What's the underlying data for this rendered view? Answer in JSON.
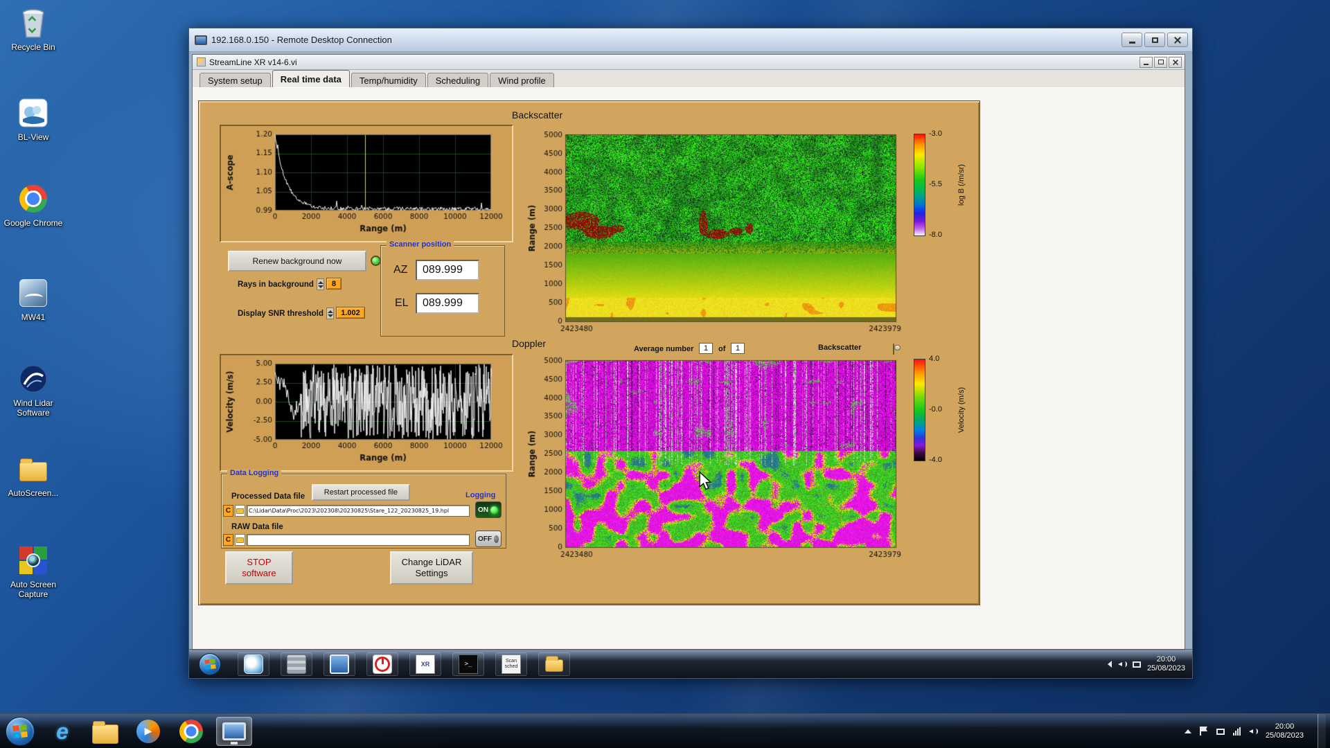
{
  "host": {
    "desktop_icons": [
      {
        "label": "Recycle Bin"
      },
      {
        "label": "BL-View"
      },
      {
        "label": "Google Chrome"
      },
      {
        "label": "MW41"
      },
      {
        "label": "Wind Lidar Software"
      },
      {
        "label": "AutoScreen..."
      },
      {
        "label": "Auto Screen Capture"
      }
    ],
    "taskbar": {
      "clock_time": "20:00",
      "clock_date": "25/08/2023"
    }
  },
  "rdp": {
    "title": "192.168.0.150 - Remote Desktop Connection",
    "taskbar": {
      "clock_time": "20:00",
      "clock_date": "25/08/2023",
      "xr_label": "XR",
      "cmd_glyph": ">_",
      "scan_line1": "Scan",
      "scan_line2": "sched"
    }
  },
  "app": {
    "title": "StreamLine XR v14-6.vi",
    "tabs": [
      "System setup",
      "Real time data",
      "Temp/humidity",
      "Scheduling",
      "Wind profile"
    ],
    "active_tab": "Real time data"
  },
  "panel": {
    "backscatter_label": "Backscatter",
    "doppler_label": "Doppler",
    "renew_button": "Renew background now",
    "rays_label": "Rays in background",
    "rays_value": "8",
    "snr_label": "Display SNR threshold",
    "snr_value": "1.002",
    "scanner": {
      "legend": "Scanner position",
      "az_label": "AZ",
      "az_value": "089.999",
      "el_label": "EL",
      "el_value": "089.999"
    },
    "average": {
      "label": "Average number",
      "value": "1",
      "of": "of",
      "total": "1"
    },
    "backscatter_toggle_label": "Backscatter",
    "logging": {
      "legend": "Data Logging",
      "processed_label": "Processed Data file",
      "restart_button": "Restart processed file",
      "logging_label": "Logging",
      "drive": "C",
      "processed_path": "C:\\Lidar\\Data\\Proc\\2023\\202308\\20230825\\Stare_122_20230825_19.hpl",
      "raw_label": "RAW Data file",
      "raw_path": "",
      "on": "ON",
      "off": "OFF"
    },
    "stop_button_line1": "STOP",
    "stop_button_line2": "software",
    "settings_button_line1": "Change LiDAR",
    "settings_button_line2": "Settings"
  },
  "charts": {
    "ascope": {
      "ylabel": "A-scope",
      "xlabel": "Range (m)",
      "yticks": [
        "1.20",
        "1.15",
        "1.10",
        "1.05",
        "0.99"
      ],
      "xticks": [
        "0",
        "2000",
        "4000",
        "6000",
        "8000",
        "10000",
        "12000"
      ],
      "cursor_x": 5000,
      "x_max": 12000
    },
    "velocity": {
      "ylabel": "Velocity (m/s)",
      "xlabel": "Range (m)",
      "yticks": [
        "5.00",
        "2.50",
        "0.00",
        "-2.50",
        "-5.00"
      ],
      "xticks": [
        "0",
        "2000",
        "4000",
        "6000",
        "8000",
        "10000",
        "12000"
      ],
      "x_max": 12000
    },
    "backscatter_map": {
      "ylabel": "Range (m)",
      "yticks": [
        "5000",
        "4500",
        "4000",
        "3500",
        "3000",
        "2500",
        "2000",
        "1500",
        "1000",
        "500",
        "0"
      ],
      "x_left": "2423480",
      "x_right": "2423979",
      "colorbar": {
        "ticks": [
          "-3.0",
          "-5.5",
          "-8.0"
        ],
        "label": "log B (/m/sr)"
      }
    },
    "doppler_map": {
      "ylabel": "Range (m)",
      "yticks": [
        "5000",
        "4500",
        "4000",
        "3500",
        "3000",
        "2500",
        "2000",
        "1500",
        "1000",
        "500",
        "0"
      ],
      "x_left": "2423480",
      "x_right": "2423979",
      "colorbar": {
        "ticks": [
          "4.0",
          "-0.0",
          "-4.0"
        ],
        "label": "Velocity (m/s)"
      }
    }
  },
  "colors": {
    "panel_tan": "#d2a55e",
    "led_green": "#37d937",
    "orange_control": "#ffa51e"
  }
}
